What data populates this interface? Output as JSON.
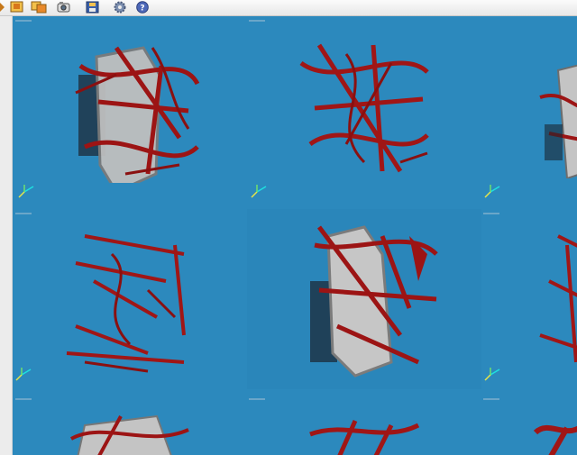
{
  "toolbar": {
    "buttons": [
      {
        "name": "arrow-partial-button",
        "icon": "arrow-icon"
      },
      {
        "name": "layout-single-button",
        "icon": "layout-icon"
      },
      {
        "name": "layout-compare-button",
        "icon": "layout-compare-icon"
      },
      {
        "name": "snapshot-button",
        "icon": "camera-icon"
      },
      {
        "name": "save-button",
        "icon": "floppy-icon"
      },
      {
        "name": "settings-button",
        "icon": "gear-icon"
      },
      {
        "name": "help-button",
        "icon": "help-icon",
        "label": "?"
      }
    ]
  },
  "viewports": {
    "background_color": "#2c89bd",
    "vessel_color": "#a01616",
    "bone_color": "#c8c8c8",
    "rows": 3,
    "cols": 3
  }
}
